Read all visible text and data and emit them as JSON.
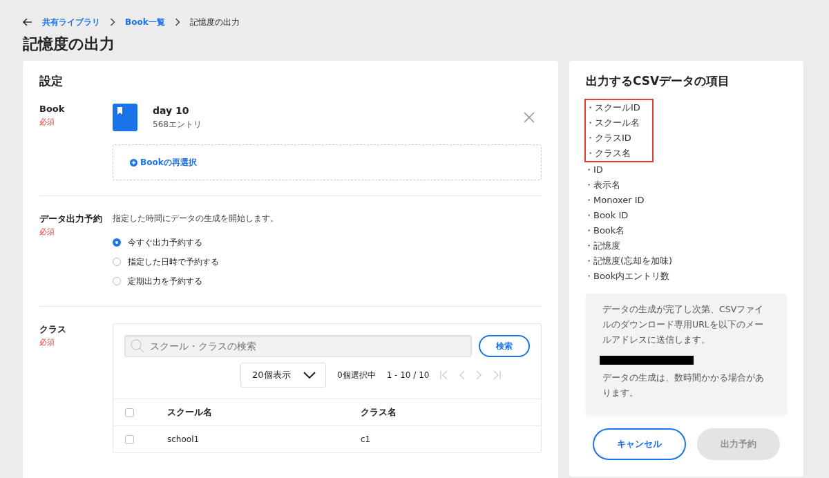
{
  "breadcrumb": [
    {
      "label": "共有ライブラリ",
      "link": true
    },
    {
      "label": "Book一覧",
      "link": true
    },
    {
      "label": "記憶度の出力",
      "link": false
    }
  ],
  "page_title": "記憶度の出力",
  "settings": {
    "title": "設定",
    "book": {
      "label": "Book",
      "required": "必須",
      "name": "day 10",
      "entries": "568エントリ",
      "reselect": "Bookの再選択"
    },
    "schedule": {
      "label": "データ出力予約",
      "required": "必須",
      "description": "指定した時間にデータの生成を開始します。",
      "options": [
        {
          "label": "今すぐ出力予約する",
          "selected": true
        },
        {
          "label": "指定した日時で予約する",
          "selected": false
        },
        {
          "label": "定期出力を予約する",
          "selected": false
        }
      ]
    },
    "class": {
      "label": "クラス",
      "required": "必須",
      "search_placeholder": "スクール・クラスの検索",
      "search_button": "検索",
      "page_size": "20個表示",
      "selected_count": "0個選択中",
      "range": "1 - 10 / 10",
      "select_all_checked": false,
      "columns": [
        "スクール名",
        "クラス名"
      ],
      "rows": [
        {
          "school": "school1",
          "class": "c1",
          "checked": false
        }
      ]
    }
  },
  "csv": {
    "title": "出力するCSVデータの項目",
    "items": [
      {
        "label": "・スクールID",
        "highlighted": true
      },
      {
        "label": "・スクール名",
        "highlighted": true
      },
      {
        "label": "・クラスID",
        "highlighted": true
      },
      {
        "label": "・クラス名",
        "highlighted": true
      },
      {
        "label": "・ID",
        "highlighted": false
      },
      {
        "label": "・表示名",
        "highlighted": false
      },
      {
        "label": "・Monoxer ID",
        "highlighted": false
      },
      {
        "label": "・Book ID",
        "highlighted": false
      },
      {
        "label": "・Book名",
        "highlighted": false
      },
      {
        "label": "・記憶度",
        "highlighted": false
      },
      {
        "label": "・記憶度(忘却を加味)",
        "highlighted": false
      },
      {
        "label": "・Book内エントリ数",
        "highlighted": false
      }
    ],
    "notice": "データの生成が完了し次第、CSVファイルのダウンロード専用URLを以下のメールアドレスに送信します。",
    "notice2": "データの生成は、数時間かかる場合があります。"
  },
  "buttons": [
    {
      "label": "キャンセル",
      "kind": "outline",
      "disabled": false
    },
    {
      "label": "出力予約",
      "kind": "primary",
      "disabled": true
    }
  ]
}
